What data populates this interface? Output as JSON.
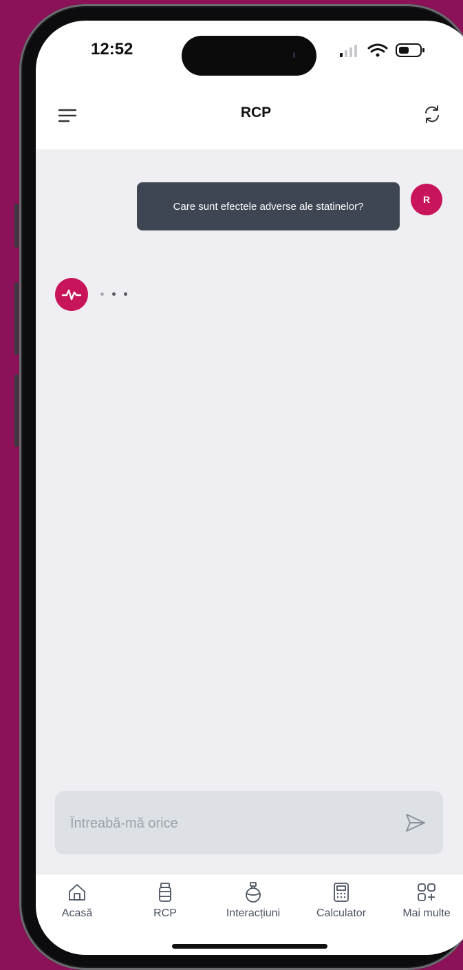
{
  "status_bar": {
    "time": "12:52"
  },
  "header": {
    "title": "RCP",
    "menu_icon": "menu-icon",
    "refresh_icon": "refresh-icon"
  },
  "chat": {
    "user_initial": "R",
    "user_message": "Care sunt efectele adverse ale statinelor?",
    "bot_icon": "pulse-icon",
    "bot_state": "typing"
  },
  "input": {
    "placeholder": "Întreabă-mă orice",
    "value": "",
    "send_icon": "send-icon"
  },
  "tabs": [
    {
      "label": "Acasă",
      "icon": "home-icon"
    },
    {
      "label": "RCP",
      "icon": "pill-bottle-icon"
    },
    {
      "label": "Interacțiuni",
      "icon": "flask-icon"
    },
    {
      "label": "Calculator",
      "icon": "calculator-icon"
    },
    {
      "label": "Mai multe",
      "icon": "grid-plus-icon"
    }
  ],
  "colors": {
    "background": "#8b1158",
    "accent": "#c8145a",
    "bubble": "#3e4654",
    "chat_background": "#efeff3",
    "input_background": "#dde1e5"
  }
}
